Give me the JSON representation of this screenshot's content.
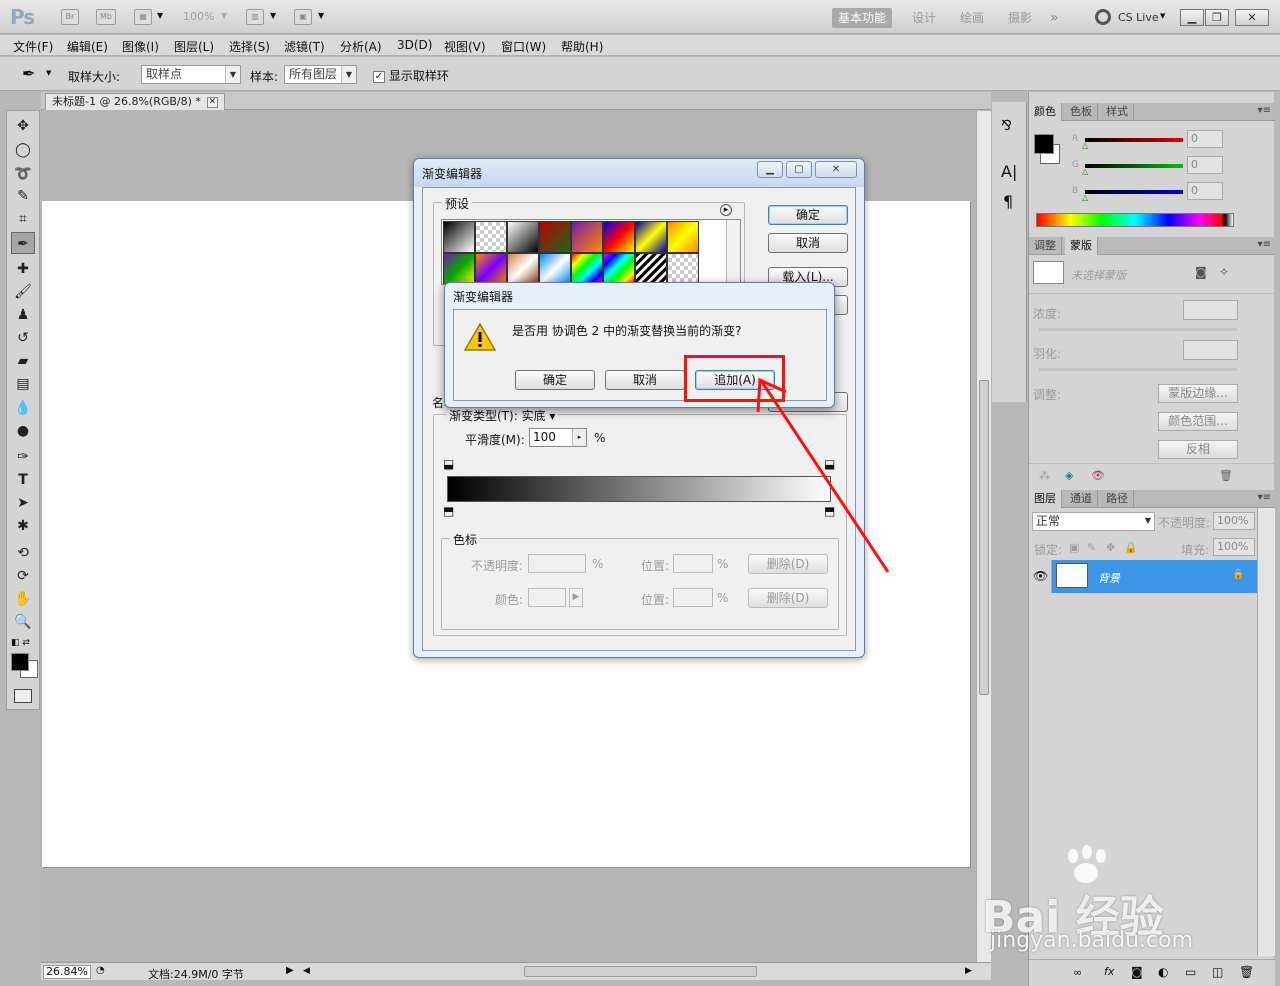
{
  "appbar": {
    "logo": "Ps",
    "bridge": "Br",
    "mini_bridge": "Mb",
    "zoom": "100%",
    "workspaces": [
      "基本功能",
      "设计",
      "绘画",
      "摄影"
    ],
    "more": "»",
    "cslive": "CS Live"
  },
  "menu": [
    "文件(F)",
    "编辑(E)",
    "图像(I)",
    "图层(L)",
    "选择(S)",
    "滤镜(T)",
    "分析(A)",
    "3D(D)",
    "视图(V)",
    "窗口(W)",
    "帮助(H)"
  ],
  "options": {
    "sample_size_label": "取样大小:",
    "sample_size_value": "取样点",
    "sample_label": "样本:",
    "sample_value": "所有图层",
    "show_ring_label": "显示取样环"
  },
  "document": {
    "tab_title": "未标题-1 @ 26.8%(RGB/8) *",
    "zoom": "26.84%",
    "doc_info": "文档:24.9M/0 字节"
  },
  "color_panel": {
    "tabs": [
      "颜色",
      "色板",
      "样式"
    ],
    "channels": [
      {
        "name": "R",
        "value": "0",
        "color": "#e00000"
      },
      {
        "name": "G",
        "value": "0",
        "color": "#00c000"
      },
      {
        "name": "B",
        "value": "0",
        "color": "#0000d0"
      }
    ]
  },
  "mask_panel": {
    "tabs": [
      "调整",
      "蒙版"
    ],
    "no_mask": "未选择蒙版",
    "density_label": "浓度:",
    "feather_label": "羽化:",
    "adjust_label": "调整:",
    "buttons": [
      "蒙版边缘...",
      "颜色范围...",
      "反相"
    ]
  },
  "layers_panel": {
    "tabs": [
      "图层",
      "通道",
      "路径"
    ],
    "blend_mode": "正常",
    "opacity_label": "不透明度:",
    "opacity_value": "100%",
    "lock_label": "锁定:",
    "fill_label": "填充:",
    "fill_value": "100%",
    "layer_name": "背景"
  },
  "gradient_editor": {
    "title": "渐变编辑器",
    "presets_label": "预设",
    "ok": "确定",
    "cancel": "取消",
    "load": "载入(L)...",
    "name_label_partial": "名称",
    "type_label": "渐变类型(T):",
    "type_value": "实底",
    "smoothness_label": "平滑度(M):",
    "smoothness_value": "100",
    "percent": "%",
    "stops_label": "色标",
    "opacity_label": "不透明度:",
    "color_label": "颜色:",
    "location_label": "位置:",
    "delete_label": "删除(D)"
  },
  "confirm_dialog": {
    "title": "渐变编辑器",
    "message": "是否用 协调色 2 中的渐变替换当前的渐变?",
    "ok": "确定",
    "cancel": "取消",
    "append": "追加(A)"
  },
  "watermark": {
    "brand": "Bai  经验",
    "url": "jingyan.baidu.com"
  },
  "colors": {
    "accent_selected": "#3d95ea",
    "highlight_red": "#ff1010"
  }
}
